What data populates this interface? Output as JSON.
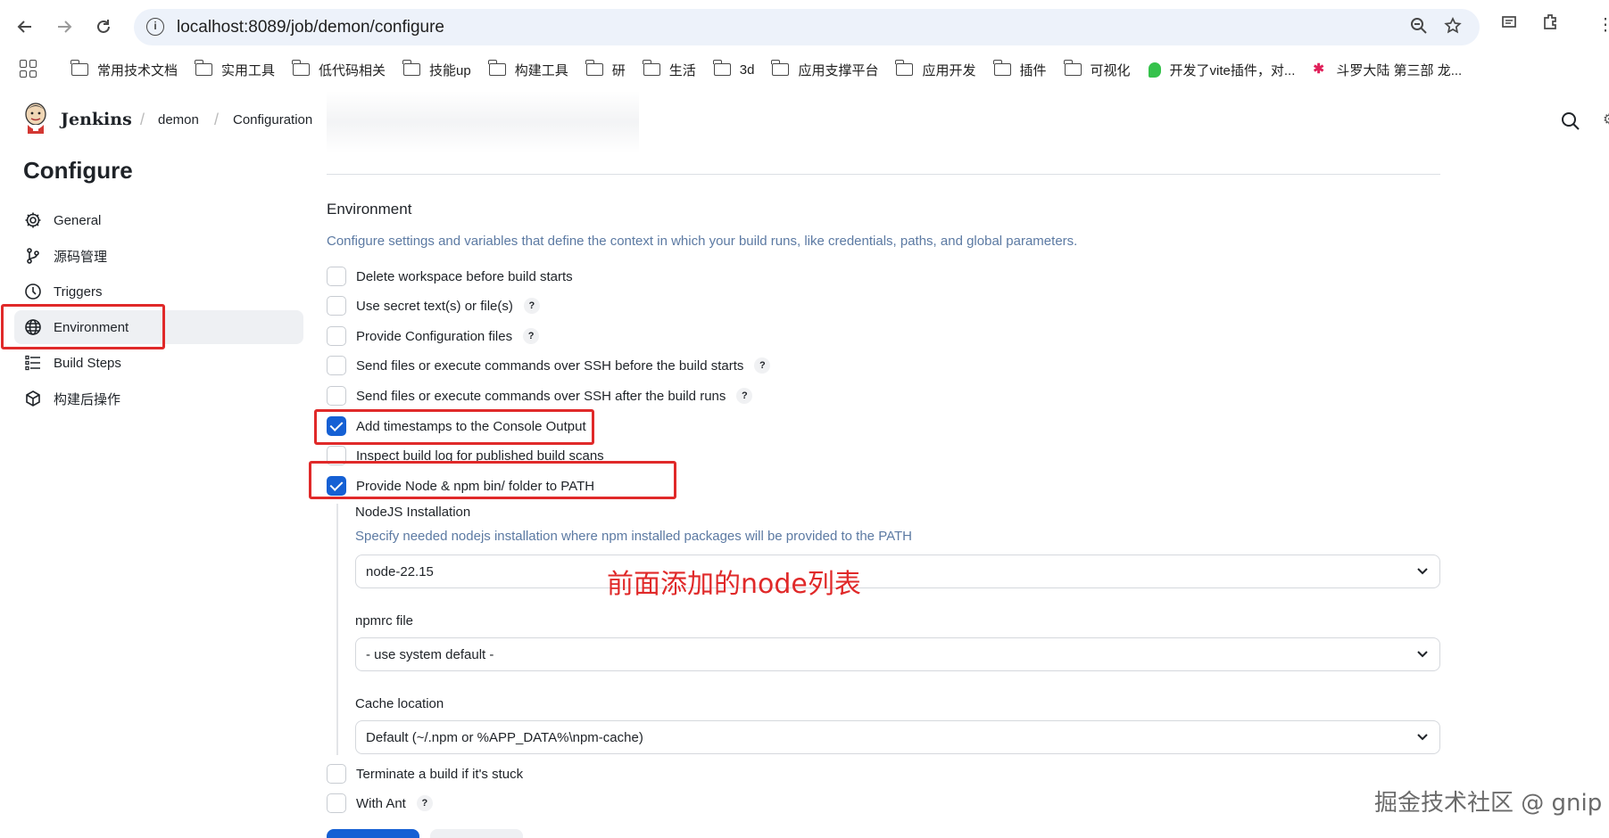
{
  "browser": {
    "url": "localhost:8089/job/demon/configure",
    "bookmarks": [
      {
        "label": "常用技术文档",
        "icon": "folder-icon"
      },
      {
        "label": "实用工具",
        "icon": "folder-icon"
      },
      {
        "label": "低代码相关",
        "icon": "folder-icon"
      },
      {
        "label": "技能up",
        "icon": "folder-icon"
      },
      {
        "label": "构建工具",
        "icon": "folder-icon"
      },
      {
        "label": "研",
        "icon": "folder-icon"
      },
      {
        "label": "生活",
        "icon": "folder-icon"
      },
      {
        "label": "3d",
        "icon": "folder-icon"
      },
      {
        "label": "应用支撑平台",
        "icon": "folder-icon"
      },
      {
        "label": "应用开发",
        "icon": "folder-icon"
      },
      {
        "label": "插件",
        "icon": "folder-icon"
      },
      {
        "label": "可视化",
        "icon": "folder-icon"
      },
      {
        "label": "开发了vite插件，对...",
        "icon": "favicon-green"
      },
      {
        "label": "斗罗大陆 第三部 龙...",
        "icon": "favicon-red"
      }
    ]
  },
  "header": {
    "brand": "Jenkins",
    "breadcrumbs": [
      "demon",
      "Configuration"
    ]
  },
  "sidebar": {
    "title": "Configure",
    "items": [
      {
        "label": "General",
        "icon": "gear-icon"
      },
      {
        "label": "源码管理",
        "icon": "git-branch-icon"
      },
      {
        "label": "Triggers",
        "icon": "clock-icon"
      },
      {
        "label": "Environment",
        "icon": "globe-icon",
        "active": true
      },
      {
        "label": "Build Steps",
        "icon": "list-icon"
      },
      {
        "label": "构建后操作",
        "icon": "cube-icon"
      }
    ]
  },
  "environment": {
    "title": "Environment",
    "description": "Configure settings and variables that define the context in which your build runs, like credentials, paths, and global parameters.",
    "options": [
      {
        "label": "Delete workspace before build starts",
        "checked": false,
        "help": false
      },
      {
        "label": "Use secret text(s) or file(s)",
        "checked": false,
        "help": true
      },
      {
        "label": "Provide Configuration files",
        "checked": false,
        "help": true
      },
      {
        "label": "Send files or execute commands over SSH before the build starts",
        "checked": false,
        "help": true
      },
      {
        "label": "Send files or execute commands over SSH after the build runs",
        "checked": false,
        "help": true
      },
      {
        "label": "Add timestamps to the Console Output",
        "checked": true,
        "help": false
      },
      {
        "label": "Inspect build log for published build scans",
        "checked": false,
        "help": false
      },
      {
        "label": "Provide Node & npm bin/ folder to PATH",
        "checked": true,
        "help": false
      }
    ],
    "node": {
      "installation_label": "NodeJS Installation",
      "installation_desc": "Specify needed nodejs installation where npm installed packages will be provided to the PATH",
      "installation_value": "node-22.15",
      "npmrc_label": "npmrc file",
      "npmrc_value": "- use system default -",
      "cache_label": "Cache location",
      "cache_value": "Default (~/.npm or %APP_DATA%\\npm-cache)"
    },
    "more_options": [
      {
        "label": "Terminate a build if it's stuck",
        "checked": false,
        "help": false
      },
      {
        "label": "With Ant",
        "checked": false,
        "help": true
      }
    ]
  },
  "annotation": "前面添加的node列表",
  "watermark": "掘金技术社区 @ gnip",
  "help_mark": "?",
  "colors": {
    "accent": "#1560d4",
    "highlight": "#e02929",
    "desc": "#5c7aa3"
  }
}
